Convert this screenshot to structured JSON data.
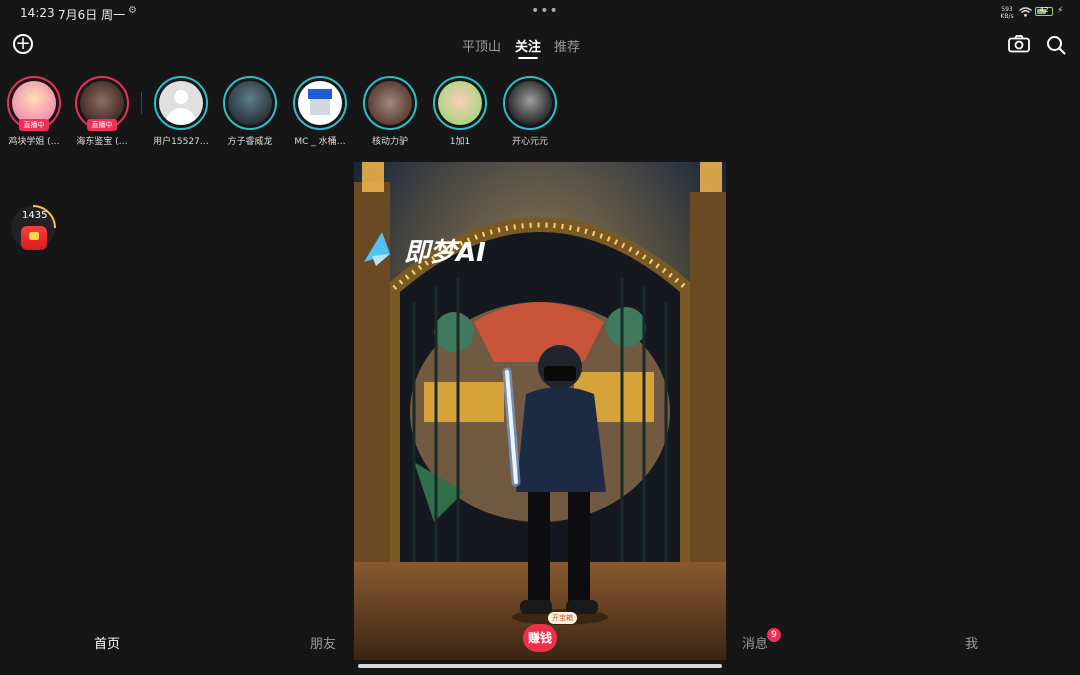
{
  "status_bar": {
    "time": "14:23",
    "date": "7月6日 周一",
    "network_speed_value": "593",
    "network_speed_unit": "KB/s",
    "battery_level": "42"
  },
  "header": {
    "tabs": [
      {
        "label": "平顶山"
      },
      {
        "label": "关注"
      },
      {
        "label": "推荐"
      }
    ],
    "selected_tab": "关注"
  },
  "stories": [
    {
      "name": "鸡块学姐 (…",
      "live": true,
      "live_label": "直播中"
    },
    {
      "name": "海东鉴宝 (…",
      "live": true,
      "live_label": "直播中"
    },
    {
      "name": "用户15527…",
      "live": false
    },
    {
      "name": "方子睿威龙",
      "live": false
    },
    {
      "name": "MC _ 水桶…",
      "live": false
    },
    {
      "name": "核动力驴",
      "live": false
    },
    {
      "name": "1加1",
      "live": false
    },
    {
      "name": "开心元元",
      "live": false
    }
  ],
  "coin_widget": {
    "count": "1435"
  },
  "video": {
    "watermark": "即梦AI"
  },
  "bottom_nav": {
    "items": [
      {
        "label": "首页"
      },
      {
        "label": "朋友"
      },
      {
        "label": "消息"
      },
      {
        "label": "我"
      }
    ],
    "earn_label": "赚钱",
    "treasure_label": "开宝箱",
    "messages_badge": "9"
  },
  "colors": {
    "background": "#161616",
    "live_accent": "#f0305a",
    "story_ring": "#2dbfc9"
  }
}
